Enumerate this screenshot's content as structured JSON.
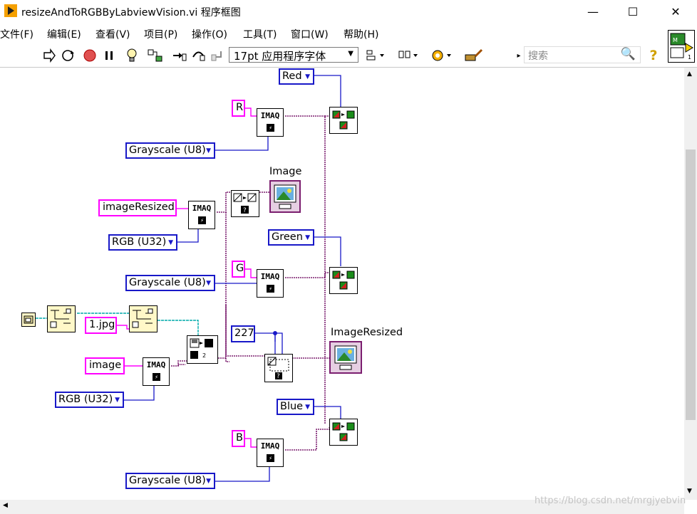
{
  "window": {
    "title": "resizeAndToRGBByLabviewVision.vi 程序框图",
    "minimize": "—",
    "maximize": "☐",
    "close": "✕"
  },
  "menu": [
    "文件(F)",
    "编辑(E)",
    "查看(V)",
    "项目(P)",
    "操作(O)",
    "工具(T)",
    "窗口(W)",
    "帮助(H)"
  ],
  "toolbar": {
    "font": "17pt 应用程序字体",
    "search_placeholder": "搜索",
    "help": "?"
  },
  "diagram": {
    "red_enum": "Red",
    "green_enum": "Green",
    "blue_enum": "Blue",
    "r_const": "R",
    "g_const": "G",
    "b_const": "B",
    "grayscale_r": "Grayscale (U8)",
    "grayscale_g": "Grayscale (U8)",
    "grayscale_b": "Grayscale (U8)",
    "rgb_resized": "RGB (U32)",
    "rgb_image": "RGB (U32)",
    "image_resized_name": "imageResized",
    "image_name": "image",
    "file_name": "1.jpg",
    "size_const": "227",
    "imaq": "IMAQ",
    "image_label": "Image",
    "image_resized_label": "ImageResized"
  },
  "watermark": "https://blog.csdn.net/mrgjyebvin",
  "colors": {
    "enum_border": "#1818c8",
    "string_border": "#ff00ff",
    "image_wire": "#7b1e6f",
    "int_wire": "#1818c8",
    "path_wire": "#00aaaa"
  }
}
